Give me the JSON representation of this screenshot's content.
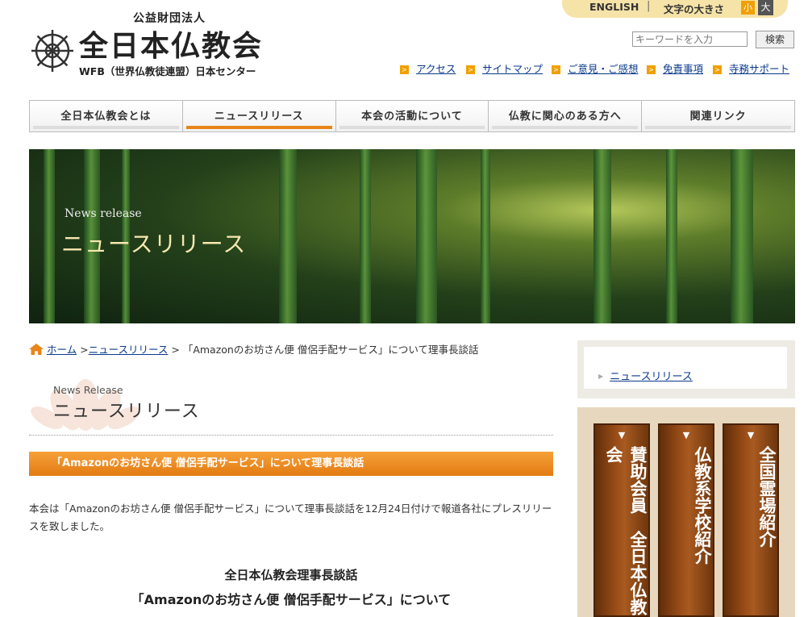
{
  "header": {
    "english_link": "ENGLISH",
    "separator": "|",
    "font_size_label": "文字の大きさ",
    "font_small": "小",
    "font_large": "大",
    "org_type": "公益財団法人",
    "site_title": "全日本仏教会",
    "site_subtitle": "WFB（世界仏教徒連盟）日本センター",
    "search_placeholder": "キーワードを入力",
    "search_button": "検索",
    "util_links": [
      "アクセス",
      "サイトマップ",
      "ご意見・ご感想",
      "免責事項",
      "寺務サポート"
    ]
  },
  "nav": {
    "items": [
      "全日本仏教会とは",
      "ニュースリリース",
      "本会の活動について",
      "仏教に関心のある方へ",
      "関連リンク"
    ],
    "active_index": 1
  },
  "hero": {
    "label_en": "News release",
    "label_jp": "ニュースリリース"
  },
  "breadcrumb": {
    "home": "ホーム",
    "sep1": ">",
    "news": "ニュースリリース",
    "sep2": ">",
    "current": "「Amazonのお坊さん便 僧侶手配サービス」について理事長談話"
  },
  "section": {
    "title_en": "News Release",
    "title_jp": "ニュースリリース"
  },
  "article": {
    "title": "「Amazonのお坊さん便 僧侶手配サービス」について理事長談話",
    "body": "本会は「Amazonのお坊さん便 僧侶手配サービス」について理事長談話を12月24日付けで報道各社にプレスリリースを致しました。",
    "statement_heading": "全日本仏教会理事長談話",
    "statement_subheading": "「Amazonのお坊さん便 僧侶手配サービス」について"
  },
  "sidebar": {
    "link": "ニュースリリース",
    "banners": [
      "賛助会員　全日本仏教会",
      "仏教系学校紹介",
      "全国霊場紹介"
    ]
  },
  "colors": {
    "accent": "#e8851a",
    "banner_brown": "#8a4514"
  }
}
